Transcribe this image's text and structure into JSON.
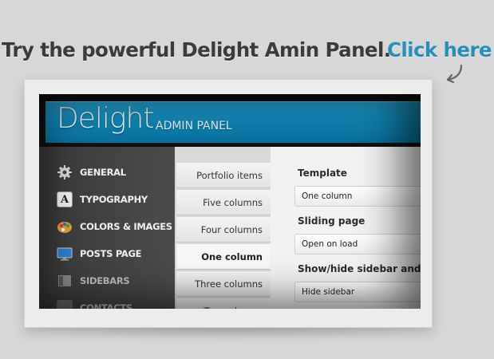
{
  "headline": {
    "text": "Try the powerful Delight Amin Panel.",
    "link": "Click here"
  },
  "panel": {
    "logo": "Delight",
    "logo_sub": "ADMIN PANEL",
    "sidebar": [
      {
        "label": "GENERAL",
        "icon": "gear-icon"
      },
      {
        "label": "TYPOGRAPHY",
        "icon": "font-letter-a-icon"
      },
      {
        "label": "COLORS & IMAGES",
        "icon": "palette-icon"
      },
      {
        "label": "POSTS PAGE",
        "icon": "monitor-icon"
      },
      {
        "label": "SIDEBARS",
        "icon": "sidebar-layout-icon"
      },
      {
        "label": "CONTACTS",
        "icon": "contacts-icon"
      }
    ],
    "subnav": [
      {
        "label": "Portfolio items"
      },
      {
        "label": "Five columns"
      },
      {
        "label": "Four columns"
      },
      {
        "label": "One column",
        "active": true
      },
      {
        "label": "Three columns"
      },
      {
        "label": "Two columns"
      }
    ],
    "settings": [
      {
        "label": "Template",
        "value": "One column"
      },
      {
        "label": "Sliding page",
        "value": "Open on load"
      },
      {
        "label": "Show/hide sidebar and its position",
        "value": "Hide sidebar"
      }
    ]
  },
  "colors": {
    "link": "#2a8fb8",
    "banner": "#1496c9",
    "sidebar": "#424242"
  }
}
